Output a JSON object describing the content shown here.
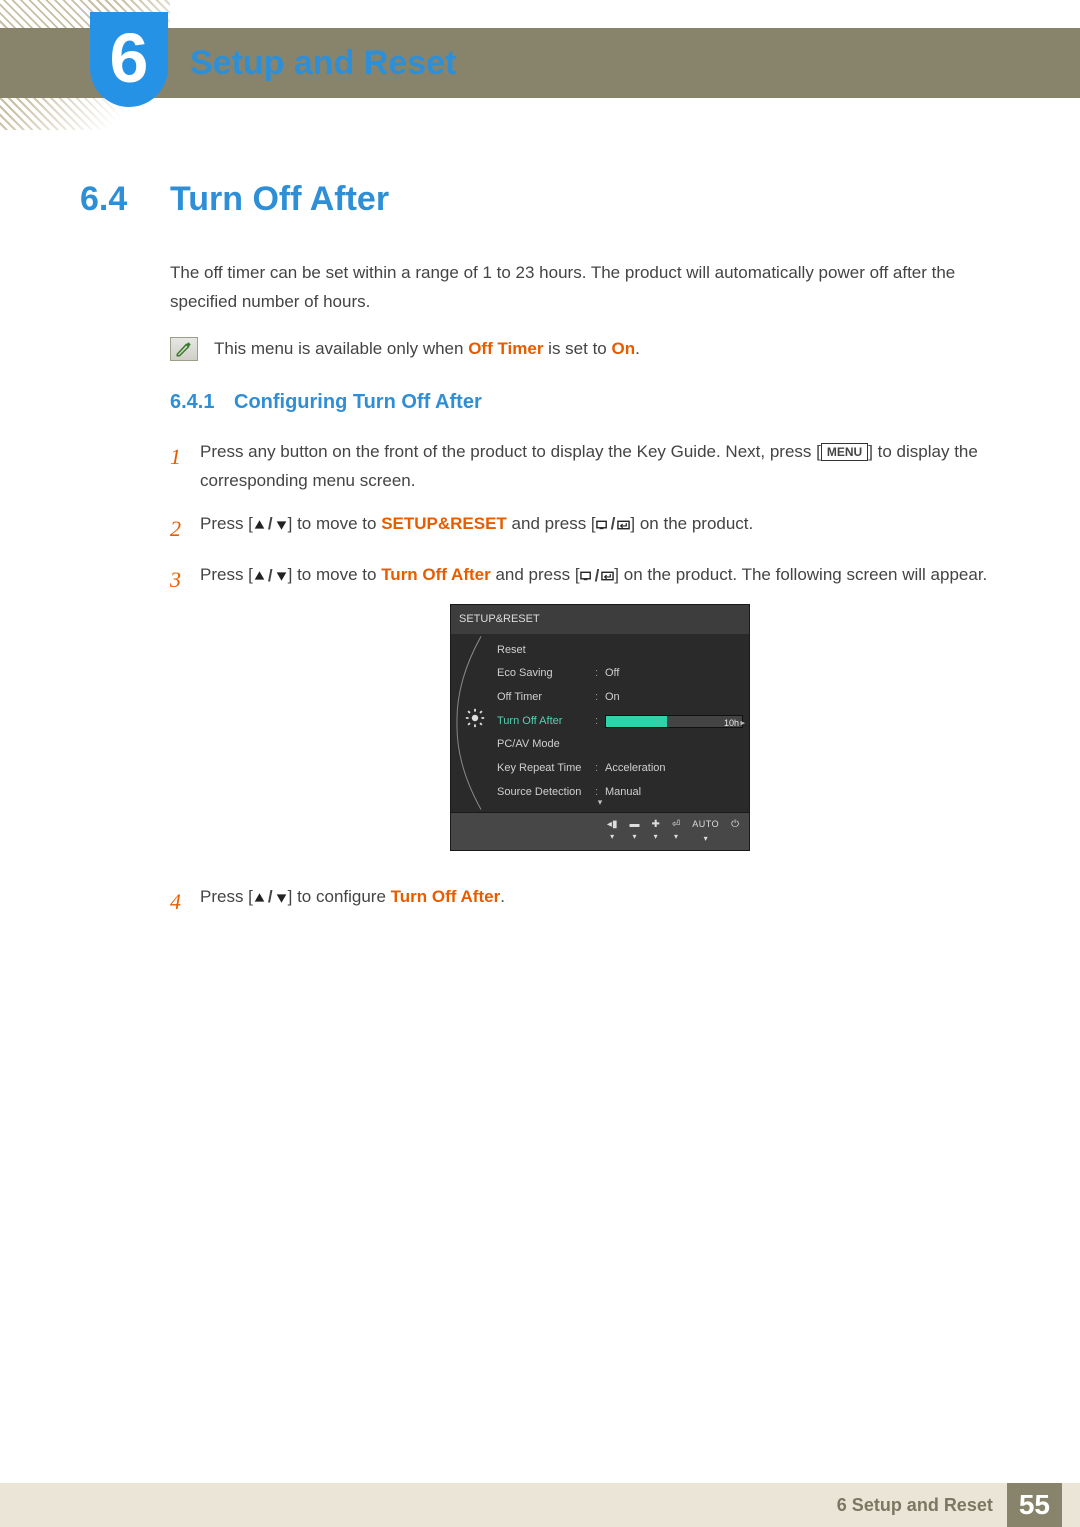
{
  "chapter": {
    "number": "6",
    "title": "Setup and Reset"
  },
  "section": {
    "num": "6.4",
    "title": "Turn Off After",
    "intro": "The off timer can be set within a range of 1 to 23 hours. The product will automatically power off after the specified number of hours."
  },
  "note": {
    "prefix": "This menu is available only when ",
    "b1": "Off Timer",
    "mid": " is set to ",
    "b2": "On",
    "suffix": "."
  },
  "subsection": {
    "num": "6.4.1",
    "title": "Configuring Turn Off After"
  },
  "steps": {
    "s1": {
      "num": "1",
      "a": "Press any button on the front of the product to display the Key Guide. Next, press [",
      "menu": "MENU",
      "b": "] to display the corresponding menu screen."
    },
    "s2": {
      "num": "2",
      "a": "Press [",
      "b": "] to move to ",
      "target": "SETUP&RESET",
      "c": " and press [",
      "d": "] on the product."
    },
    "s3": {
      "num": "3",
      "a": "Press [",
      "b": "] to move to ",
      "target": "Turn Off After",
      "c": " and press [",
      "d": "] on the product. The following screen will appear."
    },
    "s4": {
      "num": "4",
      "a": "Press [",
      "b": "] to configure ",
      "target": "Turn Off After",
      "c": "."
    }
  },
  "osd": {
    "title": "SETUP&RESET",
    "rows": {
      "reset": "Reset",
      "eco": "Eco Saving",
      "eco_v": "Off",
      "timer": "Off Timer",
      "timer_v": "On",
      "turnoff": "Turn Off After",
      "turnoff_v": "10h",
      "pcav": "PC/AV Mode",
      "keyrep": "Key Repeat Time",
      "keyrep_v": "Acceleration",
      "srcdet": "Source Detection",
      "srcdet_v": "Manual"
    },
    "footer": {
      "auto": "AUTO"
    }
  },
  "footer": {
    "text": "6 Setup and Reset",
    "page": "55"
  }
}
